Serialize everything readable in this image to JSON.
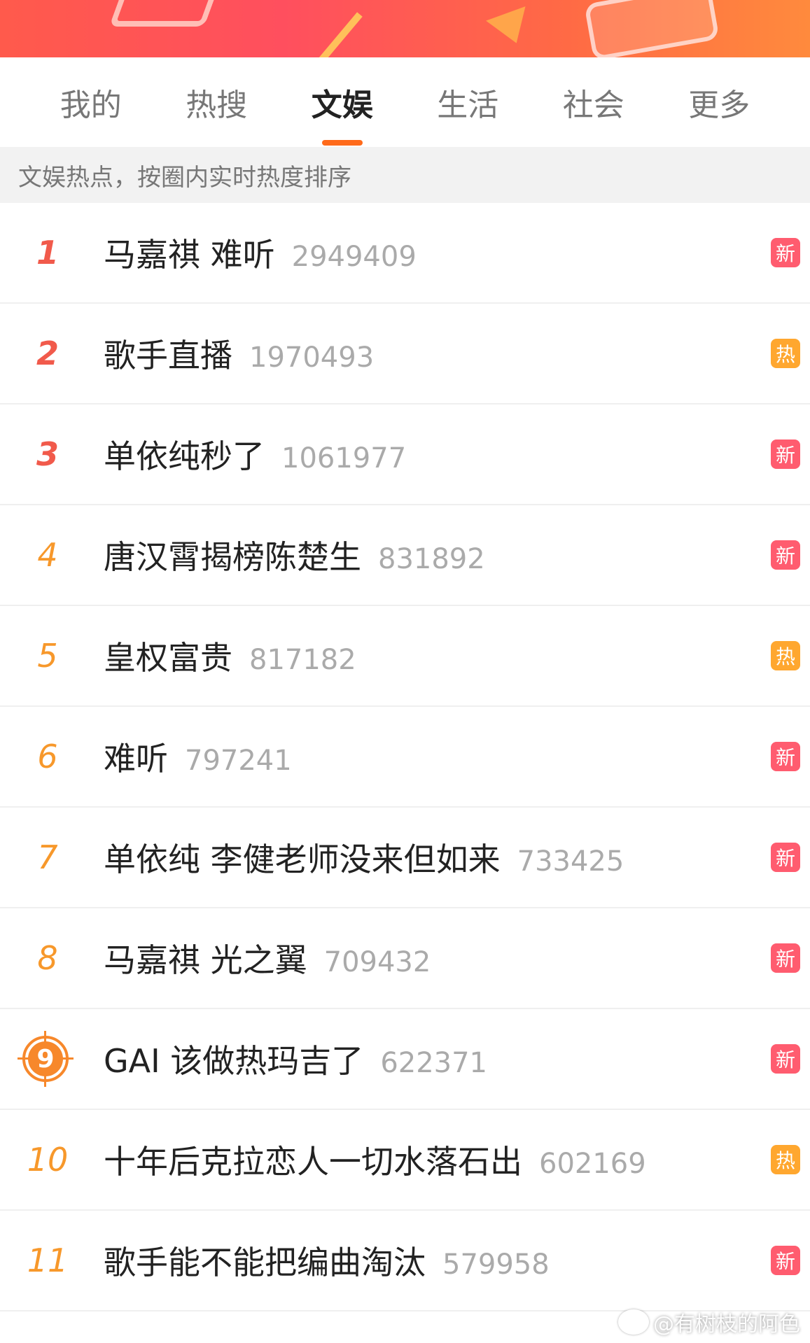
{
  "tabs": [
    {
      "label": "我的"
    },
    {
      "label": "热搜"
    },
    {
      "label": "文娱"
    },
    {
      "label": "生活"
    },
    {
      "label": "社会"
    },
    {
      "label": "更多"
    }
  ],
  "active_tab": "文娱",
  "subheader": "文娱热点，按圈内实时热度排序",
  "items": [
    {
      "rank": "1",
      "title": "马嘉祺 难听",
      "count": "2949409",
      "badge": "新"
    },
    {
      "rank": "2",
      "title": "歌手直播",
      "count": "1970493",
      "badge": "热"
    },
    {
      "rank": "3",
      "title": "单依纯秒了",
      "count": "1061977",
      "badge": "新"
    },
    {
      "rank": "4",
      "title": "唐汉霄揭榜陈楚生",
      "count": "831892",
      "badge": "新"
    },
    {
      "rank": "5",
      "title": "皇权富贵",
      "count": "817182",
      "badge": "热"
    },
    {
      "rank": "6",
      "title": "难听",
      "count": "797241",
      "badge": "新"
    },
    {
      "rank": "7",
      "title": "单依纯 李健老师没来但如来",
      "count": "733425",
      "badge": "新"
    },
    {
      "rank": "8",
      "title": "马嘉祺 光之翼",
      "count": "709432",
      "badge": "新"
    },
    {
      "rank": "9",
      "title": "GAI 该做热玛吉了",
      "count": "622371",
      "badge": "新"
    },
    {
      "rank": "10",
      "title": "十年后克拉恋人一切水落石出",
      "count": "602169",
      "badge": "热"
    },
    {
      "rank": "11",
      "title": "歌手能不能把编曲淘汰",
      "count": "579958",
      "badge": "新"
    }
  ],
  "watermark": "@有树枝的阿色",
  "colors": {
    "accent": "#ff6a1a",
    "rank_top": "#f15a4b",
    "rank_mid": "#f7982b",
    "badge_new": "#ff5c6f",
    "badge_hot": "#ffa72f"
  }
}
